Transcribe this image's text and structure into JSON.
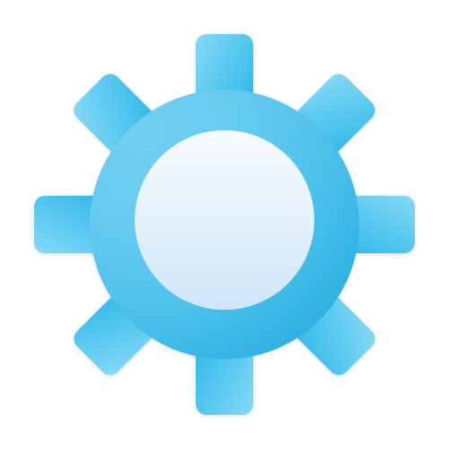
{
  "icon": {
    "name": "gear-icon",
    "meaning": "settings",
    "colors": {
      "gear_light": "#86D9F6",
      "gear_mid": "#4CC4EE",
      "gear_dark": "#22AEE3",
      "center_top": "#F7FBFE",
      "center_bottom": "#CFE6F8",
      "background": "#FFFFFF"
    }
  }
}
